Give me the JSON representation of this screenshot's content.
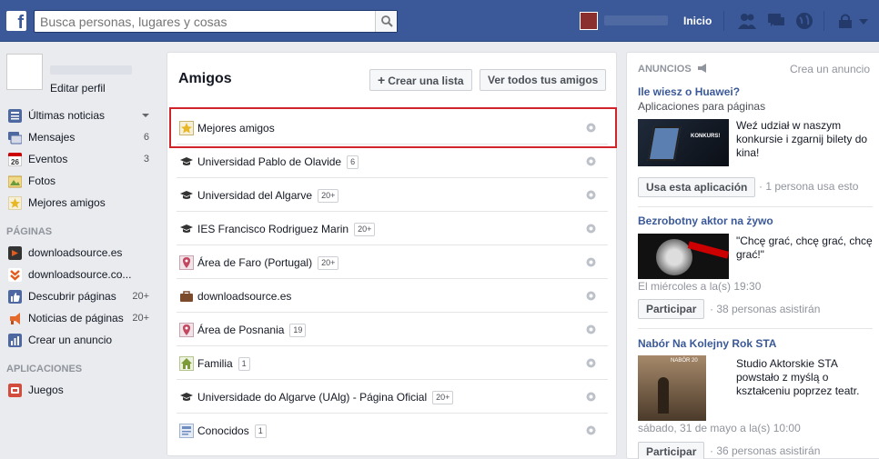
{
  "topbar": {
    "logo": "f",
    "search_placeholder": "Busca personas, lugares y cosas",
    "home_label": "Inicio"
  },
  "left": {
    "edit_profile": "Editar perfil",
    "nav": [
      {
        "label": "Últimas noticias",
        "count": "",
        "icon": "news-feed-icon"
      },
      {
        "label": "Mensajes",
        "count": "6",
        "icon": "messages-icon"
      },
      {
        "label": "Eventos",
        "count": "3",
        "icon": "calendar-icon"
      },
      {
        "label": "Fotos",
        "count": "",
        "icon": "photos-icon"
      },
      {
        "label": "Mejores amigos",
        "count": "",
        "icon": "star-list-icon"
      }
    ],
    "pages_header": "PÁGINAS",
    "pages": [
      {
        "label": "downloadsource.es",
        "count": ""
      },
      {
        "label": "downloadsource.co...",
        "count": ""
      },
      {
        "label": "Descubrir páginas",
        "count": "20+"
      },
      {
        "label": "Noticias de páginas",
        "count": "20+"
      },
      {
        "label": "Crear un anuncio",
        "count": ""
      }
    ],
    "apps_header": "APLICACIONES",
    "apps": [
      {
        "label": "Juegos"
      }
    ]
  },
  "main": {
    "title": "Amigos",
    "create_list": "Crear una lista",
    "see_all": "Ver todos tus amigos",
    "lists": [
      {
        "name": "Mejores amigos",
        "badge": "",
        "icon": "star-icon"
      },
      {
        "name": "Universidad Pablo de Olavide",
        "badge": "6",
        "icon": "graduation-cap-icon"
      },
      {
        "name": "Universidad del Algarve",
        "badge": "20+",
        "icon": "graduation-cap-icon"
      },
      {
        "name": "IES Francisco Rodriguez Marin",
        "badge": "20+",
        "icon": "graduation-cap-icon"
      },
      {
        "name": "Área de Faro (Portugal)",
        "badge": "20+",
        "icon": "location-pin-icon"
      },
      {
        "name": "downloadsource.es",
        "badge": "",
        "icon": "briefcase-icon"
      },
      {
        "name": "Área de Posnania",
        "badge": "19",
        "icon": "location-pin-icon"
      },
      {
        "name": "Familia",
        "badge": "1",
        "icon": "house-icon"
      },
      {
        "name": "Universidade do Algarve (UAlg) - Página Oficial",
        "badge": "20+",
        "icon": "graduation-cap-icon"
      },
      {
        "name": "Conocidos",
        "badge": "1",
        "icon": "acquaintances-icon"
      }
    ]
  },
  "ads": {
    "header": "ANUNCIOS",
    "create": "Crea un anuncio",
    "items": [
      {
        "title": "Ile wiesz o Huawei?",
        "subtitle": "Aplicaciones para páginas",
        "text": "Weź udział w naszym konkursie i zgarnij bilety do kina!",
        "image_text": "KONKURS!",
        "button": "Usa esta aplicación",
        "meta": "· 1 persona usa esto",
        "date": ""
      },
      {
        "title": "Bezrobotny aktor na żywo",
        "subtitle": "",
        "text": "\"Chcę grać, chcę grać, chcę grać!\"",
        "image_text": "",
        "button": "Participar",
        "meta": "· 38 personas asistirán",
        "date": "El miércoles a la(s) 19:30"
      },
      {
        "title": "Nabór Na Kolejny Rok STA",
        "subtitle": "",
        "text": "Studio Aktorskie STA powstało z myślą o kształceniu poprzez teatr.",
        "image_text": "NABÓR 20",
        "button": "Participar",
        "meta": "· 36 personas asistirán",
        "date": "sábado, 31 de mayo a la(s) 10:00"
      }
    ]
  }
}
